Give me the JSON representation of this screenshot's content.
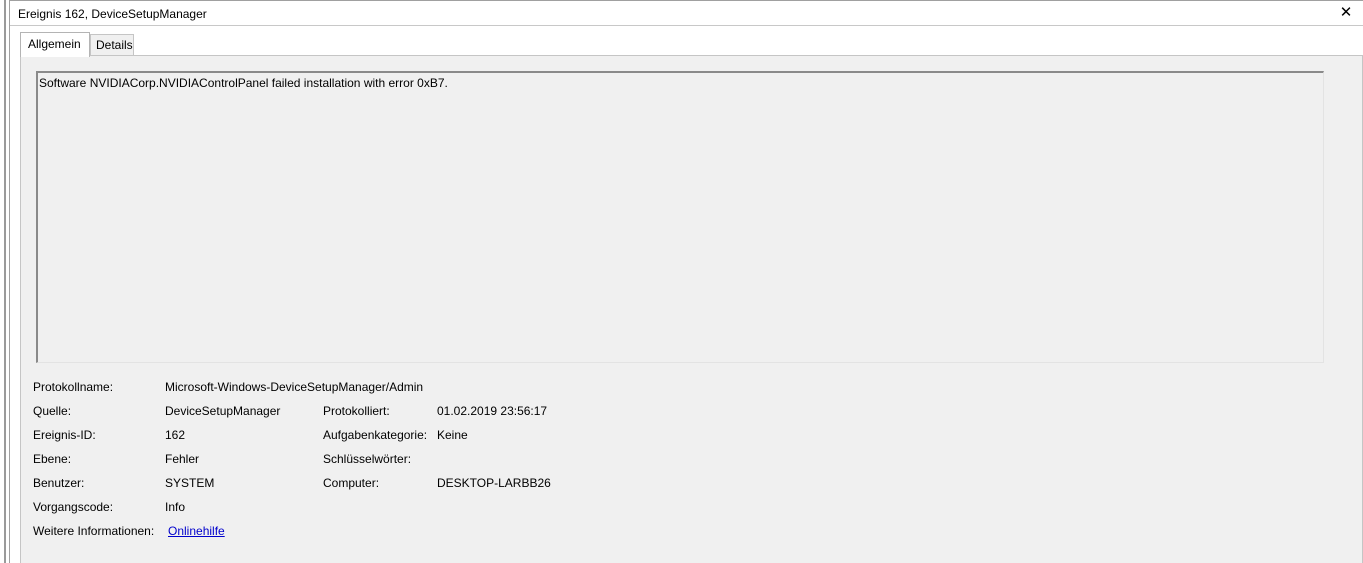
{
  "window": {
    "title": "Ereignis 162, DeviceSetupManager",
    "close_glyph": "✕"
  },
  "tabs": [
    {
      "label": "Allgemein",
      "active": true
    },
    {
      "label": "Details",
      "active": false
    }
  ],
  "message": "Software NVIDIACorp.NVIDIAControlPanel failed installation with error 0xB7.",
  "fields": {
    "protokollname": {
      "label": "Protokollname:",
      "value": "Microsoft-Windows-DeviceSetupManager/Admin"
    },
    "quelle": {
      "label": "Quelle:",
      "value": "DeviceSetupManager"
    },
    "protokolliert": {
      "label": "Protokolliert:",
      "value": "01.02.2019 23:56:17"
    },
    "ereignis_id": {
      "label": "Ereignis-ID:",
      "value": "162"
    },
    "aufgabenkategorie": {
      "label": "Aufgabenkategorie:",
      "value": "Keine"
    },
    "ebene": {
      "label": "Ebene:",
      "value": "Fehler"
    },
    "schluesselwoerter": {
      "label": "Schlüsselwörter:",
      "value": ""
    },
    "benutzer": {
      "label": "Benutzer:",
      "value": "SYSTEM"
    },
    "computer": {
      "label": "Computer:",
      "value": "DESKTOP-LARBB26"
    },
    "vorgangscode": {
      "label": "Vorgangscode:",
      "value": "Info"
    },
    "weitere_informationen": {
      "label": "Weitere Informationen:",
      "link_text": "Onlinehilfe"
    }
  },
  "colors": {
    "panel_background": "#f0f0f0",
    "link": "#0000cc"
  }
}
